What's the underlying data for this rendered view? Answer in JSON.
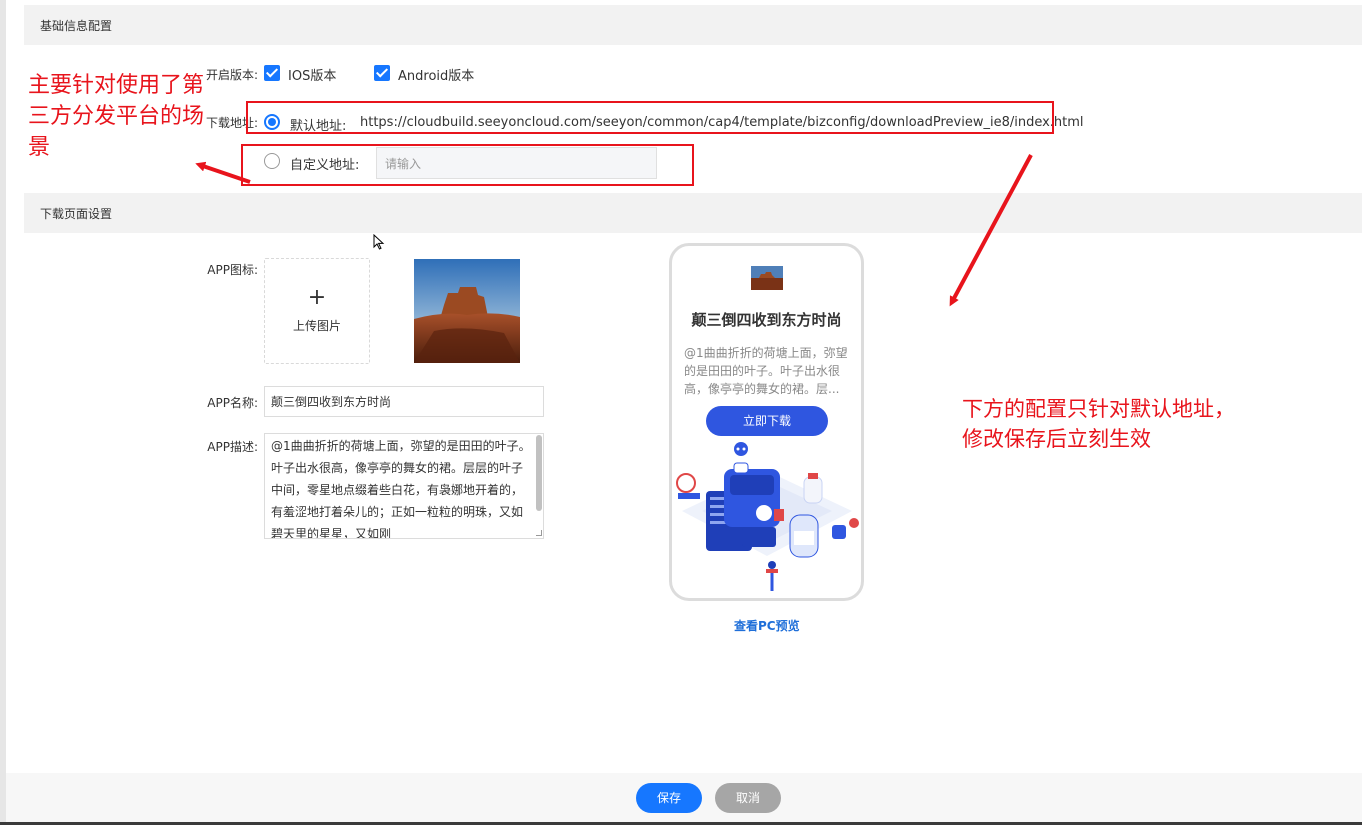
{
  "sections": {
    "basic": "基础信息配置",
    "download_page": "下载页面设置"
  },
  "version": {
    "label": "开启版本:",
    "ios": "IOS版本",
    "android": "Android版本",
    "ios_checked": true,
    "android_checked": true
  },
  "download": {
    "label": "下载地址:",
    "default_label": "默认地址:",
    "default_url": "https://cloudbuild.seeyoncloud.com/seeyon/common/cap4/template/bizconfig/downloadPreview_ie8/index.html",
    "custom_label": "自定义地址:",
    "custom_placeholder": "请输入",
    "selected": "default"
  },
  "app": {
    "icon_label": "APP图标:",
    "upload_text": "上传图片",
    "name_label": "APP名称:",
    "name_value": "颠三倒四收到东方时尚",
    "desc_label": "APP描述:",
    "desc_value": "@1曲曲折折的荷塘上面，弥望的是田田的叶子。叶子出水很高，像亭亭的舞女的裙。层层的叶子中间，零星地点缀着些白花，有袅娜地开着的，有羞涩地打着朵儿的；正如一粒粒的明珠，又如碧天里的星星，又如刚"
  },
  "preview": {
    "title": "颠三倒四收到东方时尚",
    "desc": "@1曲曲折折的荷塘上面，弥望的是田田的叶子。叶子出水很高，像亭亭的舞女的裙。层...",
    "download_button": "立即下载",
    "pc_preview_link": "查看PC预览"
  },
  "annotations": {
    "left": "主要针对使用了第三方分发平台的场景",
    "right_line1": "下方的配置只针对默认地址，",
    "right_line2": "修改保存后立刻生效"
  },
  "footer": {
    "save": "保存",
    "cancel": "取消"
  },
  "colors": {
    "primary": "#1677ff",
    "annotation_red": "#e8141c",
    "preview_button": "#2f56e0",
    "cancel_gray": "#a6a6a6"
  }
}
